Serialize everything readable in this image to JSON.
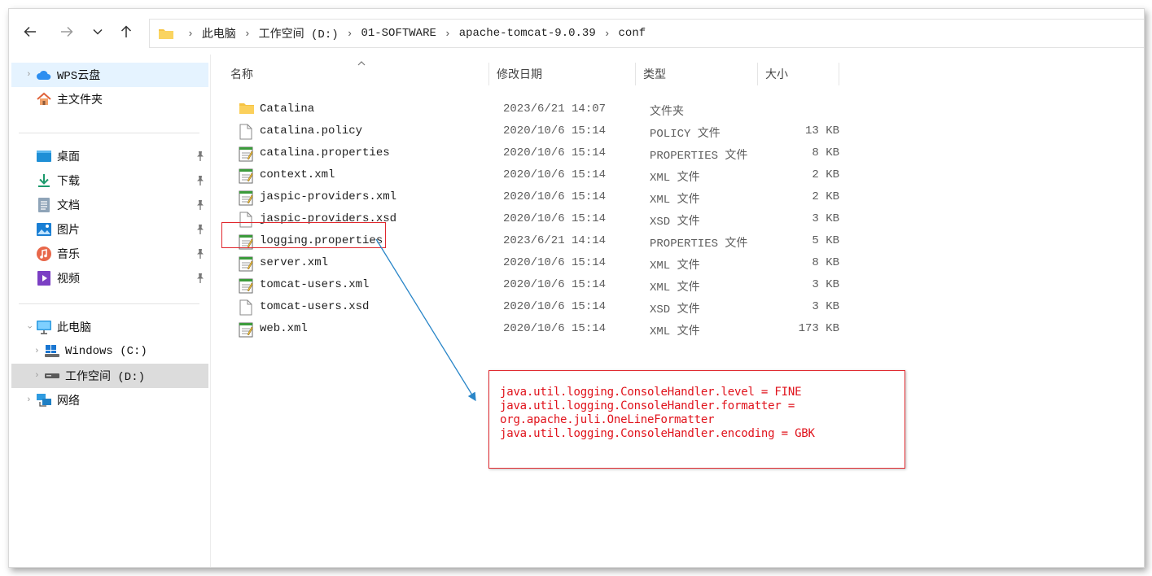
{
  "nav": {
    "back_icon": "arrow-left-icon",
    "forward_icon": "arrow-right-icon",
    "recent_icon": "chevron-down-icon",
    "up_icon": "arrow-up-icon"
  },
  "address": {
    "folder_icon": "folder-icon",
    "crumbs": [
      "此电脑",
      "工作空间 (D:)",
      "01-SOFTWARE",
      "apache-tomcat-9.0.39",
      "conf"
    ]
  },
  "sidebar": {
    "items": [
      {
        "label": "WPS云盘",
        "icon": "cloud-icon"
      },
      {
        "label": "主文件夹",
        "icon": "home-icon"
      },
      {
        "label": "桌面",
        "icon": "desktop-icon"
      },
      {
        "label": "下载",
        "icon": "download-icon"
      },
      {
        "label": "文档",
        "icon": "document-icon"
      },
      {
        "label": "图片",
        "icon": "picture-icon"
      },
      {
        "label": "音乐",
        "icon": "music-icon"
      },
      {
        "label": "视频",
        "icon": "video-icon"
      },
      {
        "label": "此电脑",
        "icon": "computer-icon"
      },
      {
        "label": "Windows (C:)",
        "icon": "windows-drive-icon"
      },
      {
        "label": "工作空间 (D:)",
        "icon": "drive-icon"
      },
      {
        "label": "网络",
        "icon": "network-icon"
      }
    ]
  },
  "columns": {
    "name": "名称",
    "date": "修改日期",
    "type": "类型",
    "size": "大小"
  },
  "files": [
    {
      "name": "Catalina",
      "date": "2023/6/21 14:07",
      "type": "文件夹",
      "size": "",
      "icon": "folder-icon"
    },
    {
      "name": "catalina.policy",
      "date": "2020/10/6 15:14",
      "type": "POLICY 文件",
      "size": "13 KB",
      "icon": "file-icon"
    },
    {
      "name": "catalina.properties",
      "date": "2020/10/6 15:14",
      "type": "PROPERTIES 文件",
      "size": "8 KB",
      "icon": "notepad-file-icon"
    },
    {
      "name": "context.xml",
      "date": "2020/10/6 15:14",
      "type": "XML 文件",
      "size": "2 KB",
      "icon": "notepad-file-icon"
    },
    {
      "name": "jaspic-providers.xml",
      "date": "2020/10/6 15:14",
      "type": "XML 文件",
      "size": "2 KB",
      "icon": "notepad-file-icon"
    },
    {
      "name": "jaspic-providers.xsd",
      "date": "2020/10/6 15:14",
      "type": "XSD 文件",
      "size": "3 KB",
      "icon": "file-icon"
    },
    {
      "name": "logging.properties",
      "date": "2023/6/21 14:14",
      "type": "PROPERTIES 文件",
      "size": "5 KB",
      "icon": "notepad-file-icon"
    },
    {
      "name": "server.xml",
      "date": "2020/10/6 15:14",
      "type": "XML 文件",
      "size": "8 KB",
      "icon": "notepad-file-icon"
    },
    {
      "name": "tomcat-users.xml",
      "date": "2020/10/6 15:14",
      "type": "XML 文件",
      "size": "3 KB",
      "icon": "notepad-file-icon"
    },
    {
      "name": "tomcat-users.xsd",
      "date": "2020/10/6 15:14",
      "type": "XSD 文件",
      "size": "3 KB",
      "icon": "file-icon"
    },
    {
      "name": "web.xml",
      "date": "2020/10/6 15:14",
      "type": "XML 文件",
      "size": "173 KB",
      "icon": "notepad-file-icon"
    }
  ],
  "note": {
    "lines": [
      "java.util.logging.ConsoleHandler.level = FINE",
      "java.util.logging.ConsoleHandler.formatter =",
      "org.apache.juli.OneLineFormatter",
      "java.util.logging.ConsoleHandler.encoding = GBK"
    ]
  },
  "colors": {
    "annotation_red": "#e0282e",
    "note_text_red": "#e0121b",
    "arrow_blue": "#2a86c8",
    "sidebar_hover": "#e5f3ff",
    "sidebar_selected": "#dcdcdc"
  }
}
